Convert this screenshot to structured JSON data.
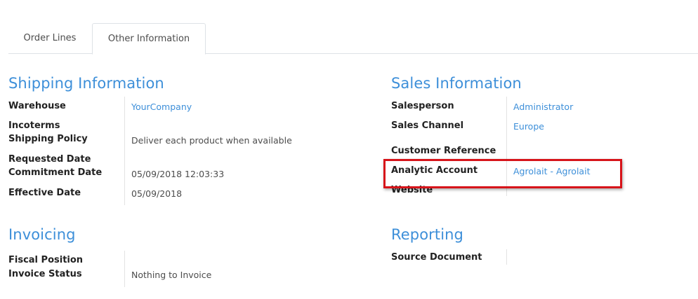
{
  "tabs": [
    {
      "label": "Order Lines"
    },
    {
      "label": "Other Information"
    }
  ],
  "shipping": {
    "title": "Shipping Information",
    "fields": {
      "warehouse_label": "Warehouse",
      "warehouse_value": "YourCompany",
      "incoterms_label": "Incoterms",
      "shipping_policy_label": "Shipping Policy",
      "shipping_policy_value": "Deliver each product when available",
      "requested_date_label": "Requested Date",
      "commitment_date_label": "Commitment Date",
      "commitment_date_value": "05/09/2018 12:03:33",
      "effective_date_label": "Effective Date",
      "effective_date_value": "05/09/2018"
    }
  },
  "sales": {
    "title": "Sales Information",
    "fields": {
      "salesperson_label": "Salesperson",
      "salesperson_value": "Administrator",
      "sales_channel_label": "Sales Channel",
      "sales_channel_value": "Europe",
      "customer_reference_label": "Customer Reference",
      "analytic_account_label": "Analytic Account",
      "analytic_account_value": "Agrolait - Agrolait",
      "website_label": "Website"
    }
  },
  "invoicing": {
    "title": "Invoicing",
    "fields": {
      "fiscal_position_label": "Fiscal Position",
      "invoice_status_label": "Invoice Status",
      "invoice_status_value": "Nothing to Invoice"
    }
  },
  "reporting": {
    "title": "Reporting",
    "fields": {
      "source_document_label": "Source Document"
    }
  },
  "colors": {
    "accent": "#3d8fd9",
    "highlight": "#d7141a"
  }
}
